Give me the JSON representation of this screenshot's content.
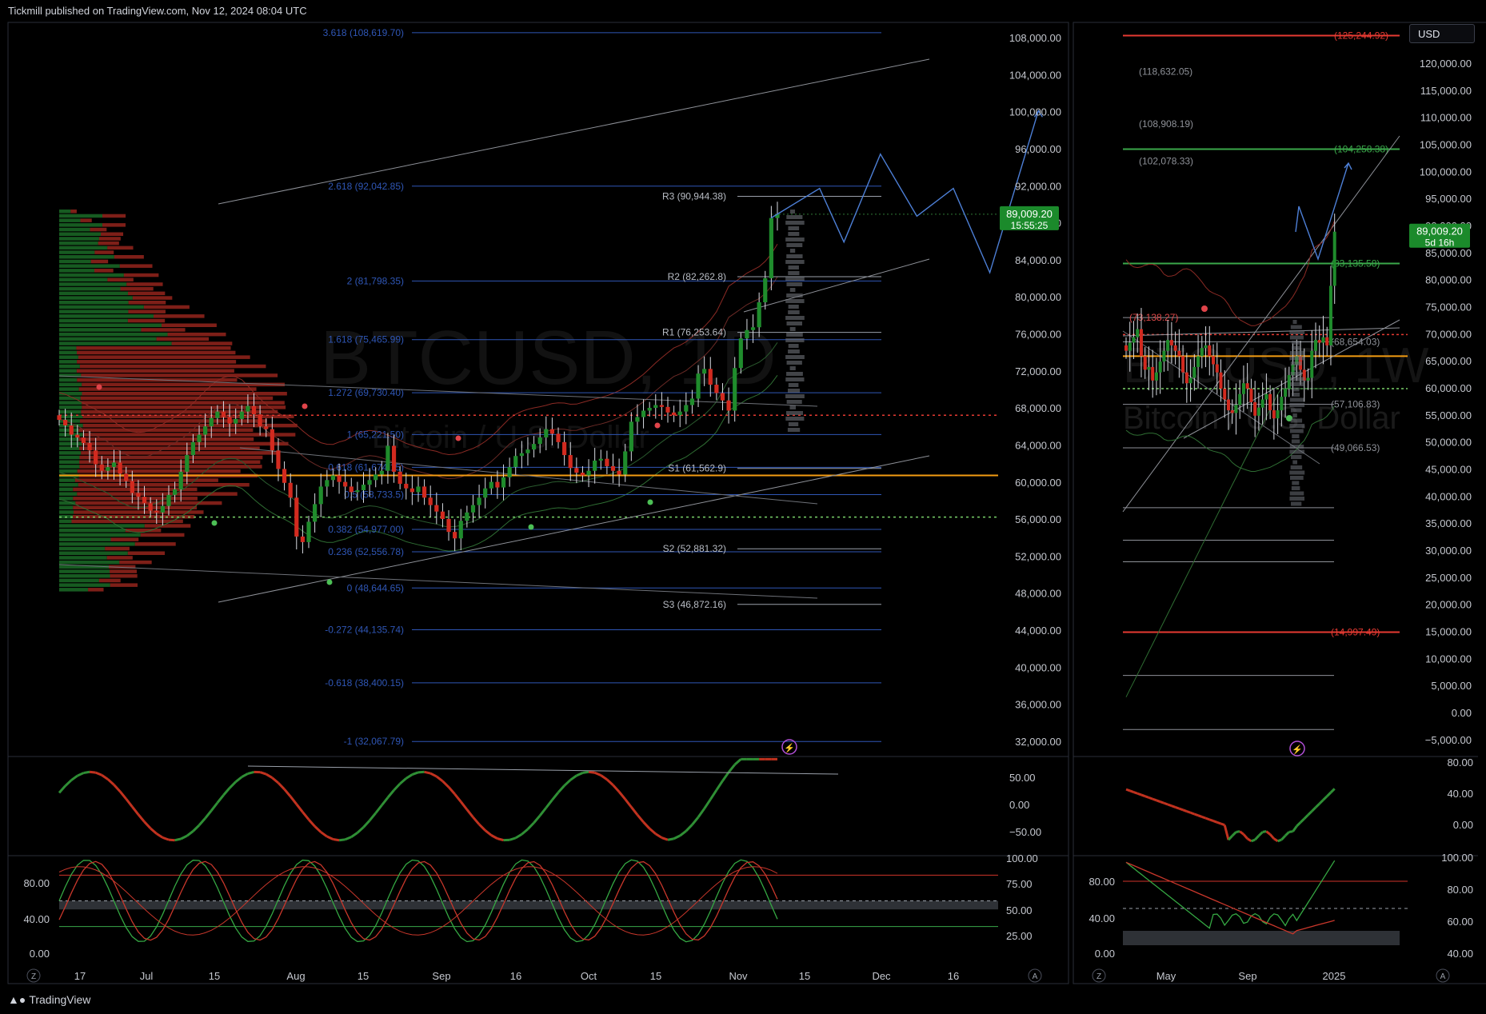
{
  "header": {
    "published": "Tickmill published on TradingView.com, Nov 12, 2024 08:04 UTC"
  },
  "footer": {
    "brand": "TradingView",
    "brand_icon": "tradingview-logo-icon"
  },
  "colors": {
    "bg": "#000000",
    "grid": "#1c1f26",
    "up": "#1f8c2c",
    "down": "#d22a1f",
    "fib": "#2f56b5",
    "pivot": "#9aa0aa",
    "level_orange": "#f39c12",
    "level_red": "#e63a32",
    "level_green": "#3aa84a",
    "projection": "#4d7fd6"
  },
  "left_panel": {
    "symbol_watermark": "BTCUSD, 1D",
    "symbol_sub": "Bitcoin / U.S. Dollar",
    "last_price": "89,009.20",
    "countdown": "15:55:25",
    "lightning_icon": "lightning-icon",
    "price_ticks": [
      "108,000.00",
      "104,000.00",
      "100,000.00",
      "96,000.00",
      "92,000.00",
      "88,000.00",
      "84,000.00",
      "80,000.00",
      "76,000.00",
      "72,000.00",
      "68,000.00",
      "64,000.00",
      "60,000.00",
      "56,000.00",
      "52,000.00",
      "48,000.00",
      "44,000.00",
      "40,000.00",
      "36,000.00",
      "32,000.00"
    ],
    "time_ticks": [
      "17",
      "Jul",
      "15",
      "Aug",
      "15",
      "Sep",
      "16",
      "Oct",
      "15",
      "Nov",
      "15",
      "Dec",
      "16"
    ],
    "fib_labels": [
      "3.618 (108,619.70)",
      "2.618 (92,042.85)",
      "2 (81,798.35)",
      "1.618 (75,465.99)",
      "1.272 (69,730.40)",
      "1 (65,221.50)",
      "0.618 (61,674.15)",
      "0.5 (58,733.5)",
      "0.382 (54,977.00)",
      "0.236 (52,556.78)",
      "0 (48,644.65)",
      "-0.272 (44,135.74)",
      "-0.618 (38,400.15)",
      "-1 (32,067.79)"
    ],
    "pivot_labels": [
      "R3 (90,944.38)",
      "R2 (82,262.8)",
      "R1 (76,253.64)",
      "S1 (61,562.9)",
      "S2 (52,881.32)",
      "S3 (46,872.16)"
    ],
    "macd_ticks": [
      "50.00",
      "0.00",
      "−50.00"
    ],
    "stoch_ticks_right": [
      "100.00",
      "75.00",
      "50.00",
      "25.00"
    ],
    "stoch_ticks_left": [
      "80.00",
      "40.00",
      "0.00"
    ],
    "z_button": "Z",
    "a_button": "A"
  },
  "right_panel": {
    "symbol_watermark": "BTCUSD, 1W",
    "symbol_sub": "Bitcoin / U.S. Dollar",
    "currency_button": "USD",
    "last_price": "89,009.20",
    "countdown": "5d 16h",
    "lightning_icon": "lightning-icon",
    "price_ticks": [
      "120,000.00",
      "115,000.00",
      "110,000.00",
      "105,000.00",
      "100,000.00",
      "95,000.00",
      "90,000.00",
      "85,000.00",
      "80,000.00",
      "75,000.00",
      "70,000.00",
      "65,000.00",
      "60,000.00",
      "55,000.00",
      "50,000.00",
      "45,000.00",
      "40,000.00",
      "35,000.00",
      "30,000.00",
      "25,000.00",
      "20,000.00",
      "15,000.00",
      "10,000.00",
      "5,000.00",
      "0.00",
      "−5,000.00"
    ],
    "time_ticks": [
      "May",
      "Sep",
      "2025"
    ],
    "level_labels": [
      "(125,244.92)",
      "(118,632.05)",
      "(108,908.19)",
      "(104,258.38)",
      "(102,078.33)",
      "(83,135.58)",
      "(73,138.27)",
      "(68,654.03)",
      "(57,106.83)",
      "(49,066.53)",
      "(14,997.49)"
    ],
    "macd_ticks": [
      "80.00",
      "40.00",
      "0.00"
    ],
    "stoch_ticks_right": [
      "100.00",
      "80.00",
      "60.00",
      "40.00"
    ],
    "stoch_ticks_left": [
      "80.00",
      "40.00",
      "0.00"
    ],
    "z_button": "Z",
    "a_button": "A"
  },
  "chart_data": [
    {
      "type": "candlestick",
      "title": "BTCUSD, 1D",
      "subtitle": "Bitcoin / U.S. Dollar",
      "ylim": [
        30000,
        110000
      ],
      "last_price": 89009.2,
      "x_labels": [
        "17",
        "Jul",
        "15",
        "Aug",
        "15",
        "Sep",
        "16",
        "Oct",
        "15",
        "Nov",
        "15",
        "Dec",
        "16"
      ],
      "close_path": [
        66800,
        66200,
        65200,
        64900,
        64300,
        63500,
        62000,
        61300,
        61700,
        62200,
        61000,
        60200,
        58900,
        58500,
        57800,
        57000,
        56800,
        57500,
        58700,
        59300,
        61200,
        63000,
        64400,
        65200,
        66100,
        67000,
        67700,
        67100,
        66400,
        66900,
        67700,
        68300,
        67400,
        66100,
        65800,
        63500,
        61500,
        60000,
        58400,
        54200,
        53600,
        55800,
        57700,
        59600,
        60300,
        60800,
        60100,
        59600,
        59000,
        59200,
        59800,
        60300,
        60900,
        61300,
        64000,
        61200,
        59900,
        59400,
        59000,
        59600,
        58400,
        57600,
        56900,
        56100,
        54700,
        54000,
        55900,
        56800,
        57600,
        58400,
        59400,
        60100,
        59500,
        60600,
        61700,
        62900,
        63200,
        63600,
        64200,
        64900,
        65800,
        65300,
        64400,
        63000,
        61600,
        61100,
        60800,
        61300,
        62400,
        62600,
        61800,
        61300,
        60900,
        63400,
        66600,
        67100,
        67800,
        68100,
        68400,
        68200,
        67600,
        67300,
        67700,
        68400,
        69100,
        71800,
        72300,
        70600,
        69700,
        68900,
        67800,
        72400,
        75600,
        76500,
        76800,
        79500,
        82100,
        88600,
        89009
      ],
      "pivots": {
        "R3": 90944.38,
        "R2": 82262.8,
        "R1": 76253.64,
        "S1": 61562.9,
        "S2": 52881.32,
        "S3": 46872.16
      },
      "fib": {
        "3.618": 108619.7,
        "2.618": 92042.85,
        "2": 81798.35,
        "1.618": 75465.99,
        "1.272": 69730.4,
        "1": 65221.5,
        "0.618": 61674.15,
        "0.5": 58733.5,
        "0.382": 54977.0,
        "0.236": 52556.78,
        "0": 48644.65,
        "-0.272": 44135.74,
        "-0.618": 38400.15,
        "-1": 32067.79
      },
      "levels": {
        "red_dotted": 67300,
        "orange": 60800,
        "green_dotted": 56300
      },
      "projection": [
        [
          0,
          88600
        ],
        [
          4,
          91800
        ],
        [
          6,
          86000
        ],
        [
          9,
          95500
        ],
        [
          12,
          88800
        ],
        [
          15,
          91800
        ],
        [
          18,
          82700
        ],
        [
          22,
          100200
        ]
      ]
    },
    {
      "type": "candlestick",
      "title": "BTCUSD, 1W",
      "subtitle": "Bitcoin / U.S. Dollar",
      "ylim": [
        -5000,
        120000
      ],
      "last_price": 89009.2,
      "x_labels": [
        "May",
        "Sep",
        "2025"
      ],
      "close_path": [
        67000,
        68500,
        69500,
        71000,
        66000,
        63500,
        64000,
        61500,
        63000,
        65000,
        67000,
        69000,
        68000,
        67000,
        66000,
        63000,
        61000,
        62000,
        64000,
        66000,
        67500,
        68000,
        66000,
        64500,
        63000,
        60000,
        58000,
        56000,
        55500,
        57000,
        59000,
        61000,
        60000,
        57500,
        55000,
        56500,
        58000,
        59000,
        56000,
        54500,
        56000,
        58500,
        60000,
        62500,
        64500,
        66000,
        63500,
        61500,
        62000,
        67000,
        69000,
        68500,
        69500,
        68000,
        79000,
        89009
      ],
      "levels": {
        "125,244.92": 125244.92,
        "104,258.38": 104258.38,
        "83,135.58": 83135.58,
        "73,138.27": 73138.27,
        "68,654.03": 68654.03,
        "57,106.83": 57106.83,
        "49,066.53": 49066.53,
        "14,997.49": 14997.49
      }
    }
  ]
}
